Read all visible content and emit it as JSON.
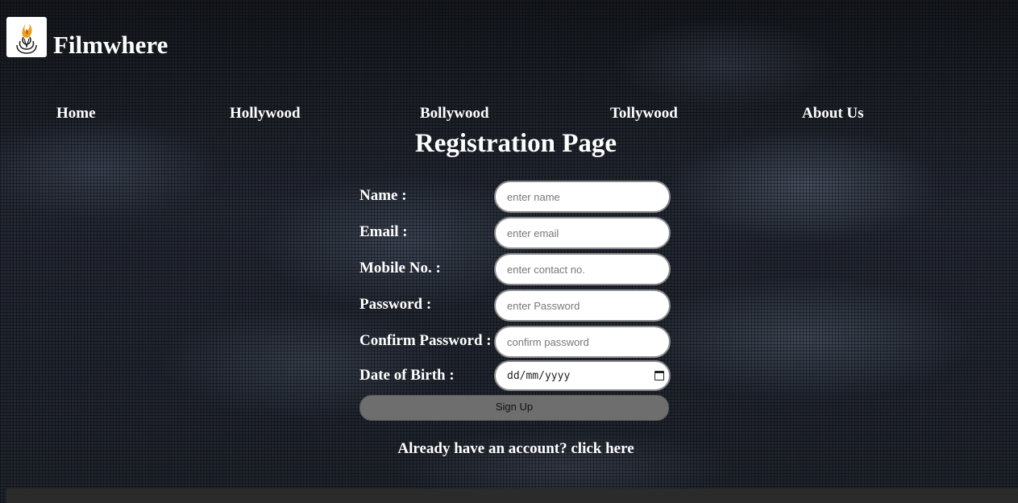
{
  "brand": {
    "name": "Filmwhere",
    "logo_icon": "flame-logo-icon"
  },
  "nav": {
    "items": [
      {
        "label": "Home"
      },
      {
        "label": "Hollywood"
      },
      {
        "label": "Bollywood"
      },
      {
        "label": "Tollywood"
      },
      {
        "label": "About Us"
      }
    ]
  },
  "page": {
    "title": "Registration Page"
  },
  "form": {
    "name": {
      "label": "Name :",
      "placeholder": "enter name"
    },
    "email": {
      "label": "Email :",
      "placeholder": "enter email"
    },
    "mobile": {
      "label": "Mobile No. :",
      "placeholder": "enter contact no."
    },
    "password": {
      "label": "Password :",
      "placeholder": "enter Password"
    },
    "confirm": {
      "label": "Confirm Password :",
      "placeholder": "confirm password"
    },
    "dob": {
      "label": "Date of Birth :",
      "value": "dd/mm/yyyy",
      "icon": "calendar-icon"
    },
    "submit_label": "Sign Up",
    "login_text": "Already have an account? click here"
  },
  "colors": {
    "button_bg": "#6e6e6e",
    "footer_bg": "#2b2b2b",
    "text": "#ffffff"
  }
}
